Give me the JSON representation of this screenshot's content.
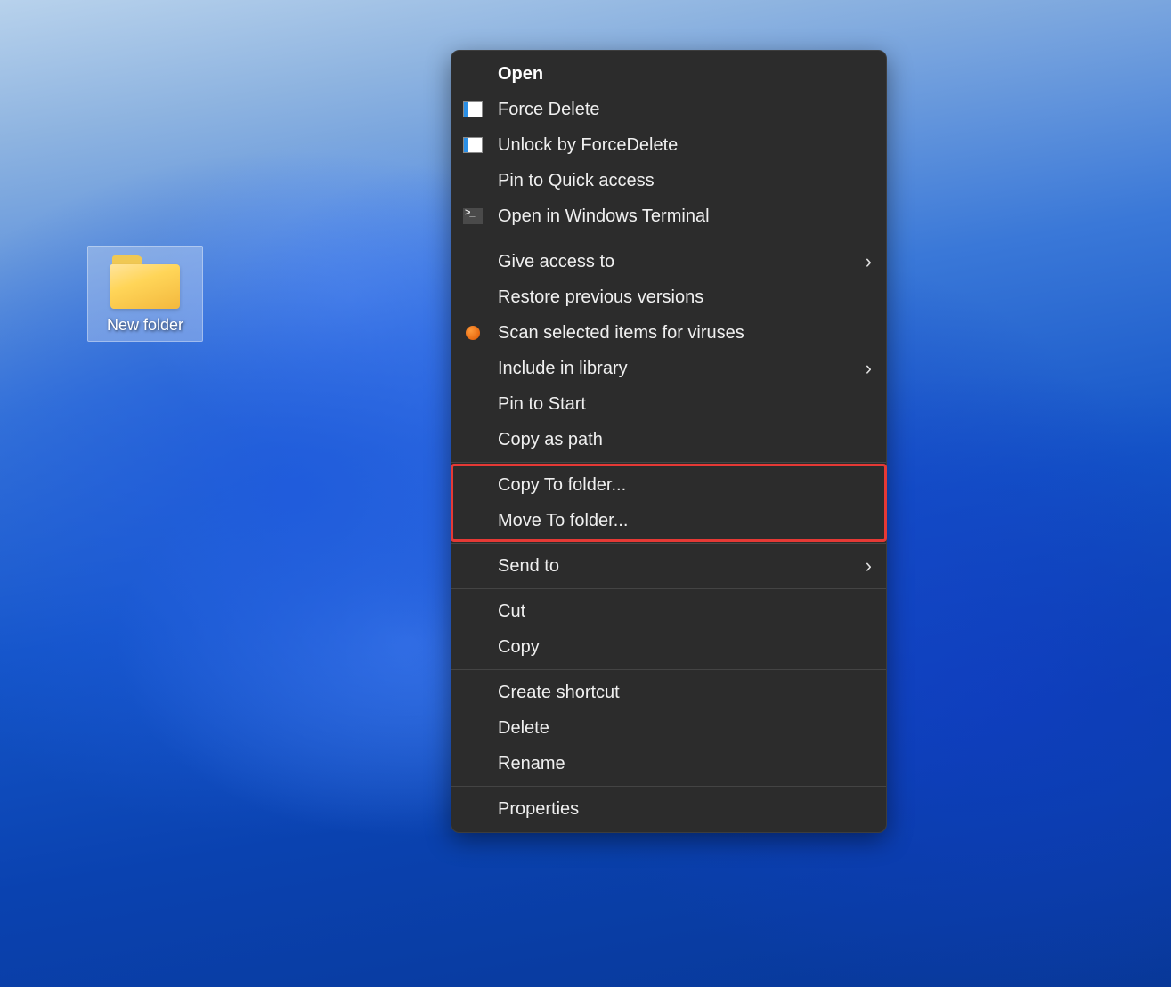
{
  "desktop": {
    "folder_label": "New folder"
  },
  "context_menu": {
    "groups": [
      {
        "items": [
          {
            "label": "Open",
            "bold": true,
            "icon": "none",
            "submenu": false
          },
          {
            "label": "Force Delete",
            "bold": false,
            "icon": "forcedelete",
            "submenu": false
          },
          {
            "label": "Unlock by ForceDelete",
            "bold": false,
            "icon": "forcedelete",
            "submenu": false
          },
          {
            "label": "Pin to Quick access",
            "bold": false,
            "icon": "none",
            "submenu": false
          },
          {
            "label": "Open in Windows Terminal",
            "bold": false,
            "icon": "terminal",
            "submenu": false
          }
        ]
      },
      {
        "items": [
          {
            "label": "Give access to",
            "bold": false,
            "icon": "none",
            "submenu": true
          },
          {
            "label": "Restore previous versions",
            "bold": false,
            "icon": "none",
            "submenu": false
          },
          {
            "label": "Scan selected items for viruses",
            "bold": false,
            "icon": "av",
            "submenu": false
          },
          {
            "label": "Include in library",
            "bold": false,
            "icon": "none",
            "submenu": true
          },
          {
            "label": "Pin to Start",
            "bold": false,
            "icon": "none",
            "submenu": false
          },
          {
            "label": "Copy as path",
            "bold": false,
            "icon": "none",
            "submenu": false
          }
        ]
      },
      {
        "highlighted": true,
        "items": [
          {
            "label": "Copy To folder...",
            "bold": false,
            "icon": "none",
            "submenu": false
          },
          {
            "label": "Move To folder...",
            "bold": false,
            "icon": "none",
            "submenu": false
          }
        ]
      },
      {
        "items": [
          {
            "label": "Send to",
            "bold": false,
            "icon": "none",
            "submenu": true
          }
        ]
      },
      {
        "items": [
          {
            "label": "Cut",
            "bold": false,
            "icon": "none",
            "submenu": false
          },
          {
            "label": "Copy",
            "bold": false,
            "icon": "none",
            "submenu": false
          }
        ]
      },
      {
        "items": [
          {
            "label": "Create shortcut",
            "bold": false,
            "icon": "none",
            "submenu": false
          },
          {
            "label": "Delete",
            "bold": false,
            "icon": "none",
            "submenu": false
          },
          {
            "label": "Rename",
            "bold": false,
            "icon": "none",
            "submenu": false
          }
        ]
      },
      {
        "items": [
          {
            "label": "Properties",
            "bold": false,
            "icon": "none",
            "submenu": false
          }
        ]
      }
    ]
  },
  "highlight_color": "#e53935"
}
